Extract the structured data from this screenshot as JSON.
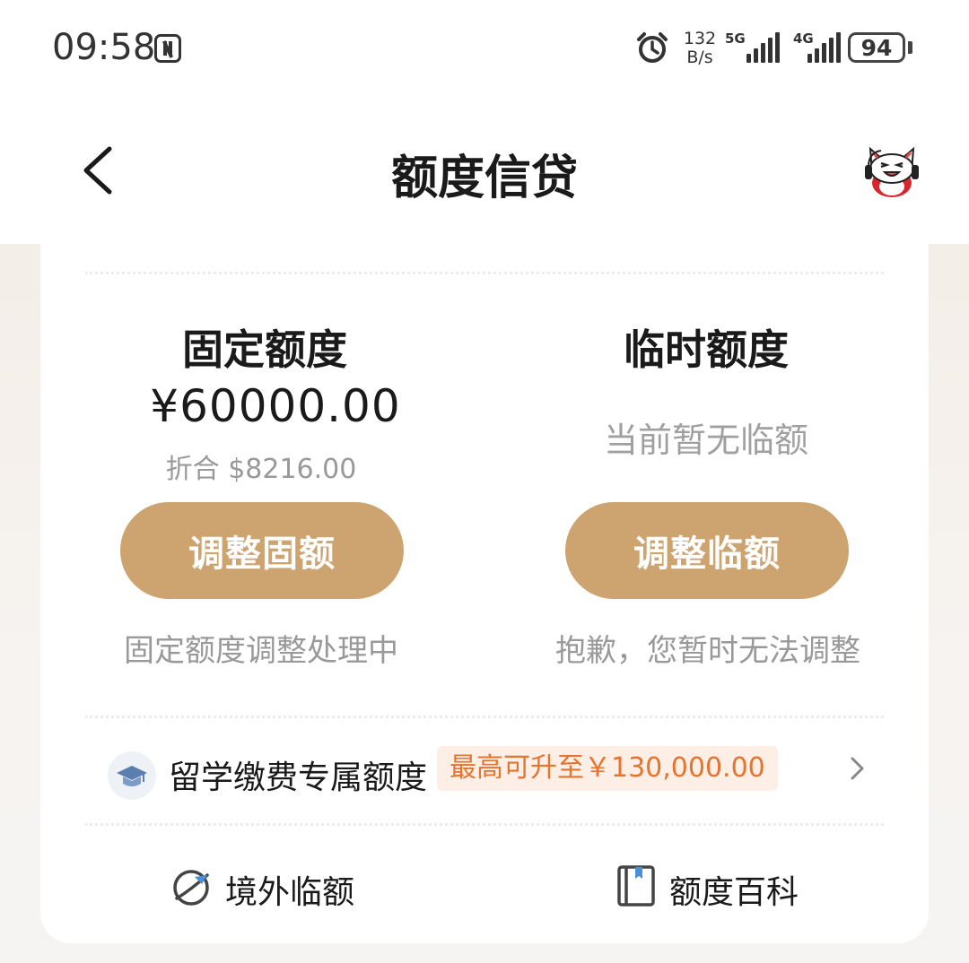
{
  "status_bar": {
    "time": "09:58",
    "speed_value": "132",
    "speed_unit": "B/s",
    "network_1": "5G",
    "network_2": "4G",
    "battery": "94"
  },
  "header": {
    "title": "额度信贷"
  },
  "fixed": {
    "title": "固定额度",
    "amount": "¥60000.00",
    "converted": "折合 $8216.00",
    "button": "调整固额",
    "note": "固定额度调整处理中"
  },
  "temp": {
    "title": "临时额度",
    "status": "当前暂无临额",
    "button": "调整临额",
    "note": "抱歉，您暂时无法调整"
  },
  "study": {
    "label": "留学缴费专属额度",
    "promo": "最高可升至￥130,000.00"
  },
  "bottom": {
    "overseas": "境外临额",
    "wiki": "额度百科"
  },
  "colors": {
    "accent": "#cda370",
    "promo_text": "#e5742f",
    "promo_bg": "#fdeee6"
  }
}
